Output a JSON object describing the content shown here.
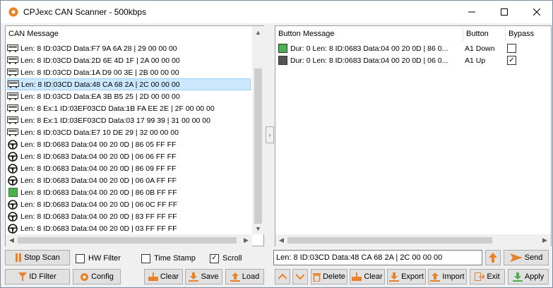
{
  "window": {
    "title": "CPJexc CAN Scanner - 500kbps",
    "controls": {
      "minimize": "—",
      "maximize": "☐",
      "close": "✕"
    }
  },
  "can_list": {
    "header": "CAN Message",
    "rows": [
      {
        "icon": "bus-icon",
        "text": "Len: 8 ID:03CD Data:F7 9A 6A 28 | 29 00 00 00"
      },
      {
        "icon": "bus-icon",
        "text": "Len: 8 ID:03CD Data:2D 6E 4D 1F | 2A 00 00 00"
      },
      {
        "icon": "bus-icon",
        "text": "Len: 8 ID:03CD Data:1A D9 00 3E | 2B 00 00 00"
      },
      {
        "icon": "bus-icon",
        "text": "Len: 8 ID:03CD Data:48 CA 68 2A | 2C 00 00 00",
        "selected": true
      },
      {
        "icon": "bus-icon",
        "text": "Len: 8 ID:03CD Data:EA 3B B5 25 | 2D 00 00 00"
      },
      {
        "icon": "bus-icon",
        "text": "Len: 8 Ex:1 ID:03EF03CD Data:1B FA EE 2E | 2F 00 00 00"
      },
      {
        "icon": "bus-icon",
        "text": "Len: 8 Ex:1 ID:03EF03CD Data:03 17 99 39 | 31 00 00 00"
      },
      {
        "icon": "bus-icon",
        "text": "Len: 8 ID:03CD Data:E7 10 DE 29 | 32 00 00 00"
      },
      {
        "icon": "steering-wheel-icon",
        "text": "Len: 8 ID:0683 Data:04 00 20 0D | 86 05 FF FF"
      },
      {
        "icon": "steering-wheel-icon",
        "text": "Len: 8 ID:0683 Data:04 00 20 0D | 06 06 FF FF"
      },
      {
        "icon": "steering-wheel-icon",
        "text": "Len: 8 ID:0683 Data:04 00 20 0D | 86 09 FF FF"
      },
      {
        "icon": "steering-wheel-icon",
        "text": "Len: 8 ID:0683 Data:04 00 20 0D | 06 0A FF FF"
      },
      {
        "icon": "green-square-icon",
        "text": "Len: 8 ID:0683 Data:04 00 20 0D | 86 0B FF FF"
      },
      {
        "icon": "steering-wheel-icon",
        "text": "Len: 8 ID:0683 Data:04 00 20 0D | 06 0C FF FF"
      },
      {
        "icon": "steering-wheel-icon",
        "text": "Len: 8 ID:0683 Data:04 00 20 0D | 83 FF FF FF"
      },
      {
        "icon": "steering-wheel-icon",
        "text": "Len: 8 ID:0683 Data:04 00 20 0D | 03 FF FF FF"
      }
    ]
  },
  "button_list": {
    "headers": {
      "message": "Button Message",
      "button": "Button",
      "bypass": "Bypass"
    },
    "rows": [
      {
        "color": "#4caf50",
        "message": "Dur:  0 Len: 8 ID:0683 Data:04 00 20 0D | 86 0...",
        "button": "A1 Down",
        "bypass": false
      },
      {
        "color": "#555555",
        "message": "Dur:  0 Len: 8 ID:0683 Data:04 00 20 0D | 06 0...",
        "button": "A1 Up",
        "bypass": true
      }
    ]
  },
  "controls": {
    "stop_scan": "Stop Scan",
    "hw_filter": {
      "label": "HW Filter",
      "checked": false
    },
    "time_stamp": {
      "label": "Time Stamp",
      "checked": false
    },
    "scroll": {
      "label": "Scroll",
      "checked": true
    },
    "message_field": "Len: 8 ID:03CD Data:48 CA 68 2A | 2C 00 00 00",
    "send": "Send",
    "id_filter": "ID Filter",
    "config": "Config",
    "clear_left": "Clear",
    "save": "Save",
    "load": "Load",
    "delete": "Delete",
    "clear_right": "Clear",
    "export": "Export",
    "import": "Import",
    "exit": "Exit",
    "apply": "Apply"
  },
  "colors": {
    "accent_orange": "#e8822a",
    "selection": "#cce8ff",
    "green": "#4caf50"
  }
}
